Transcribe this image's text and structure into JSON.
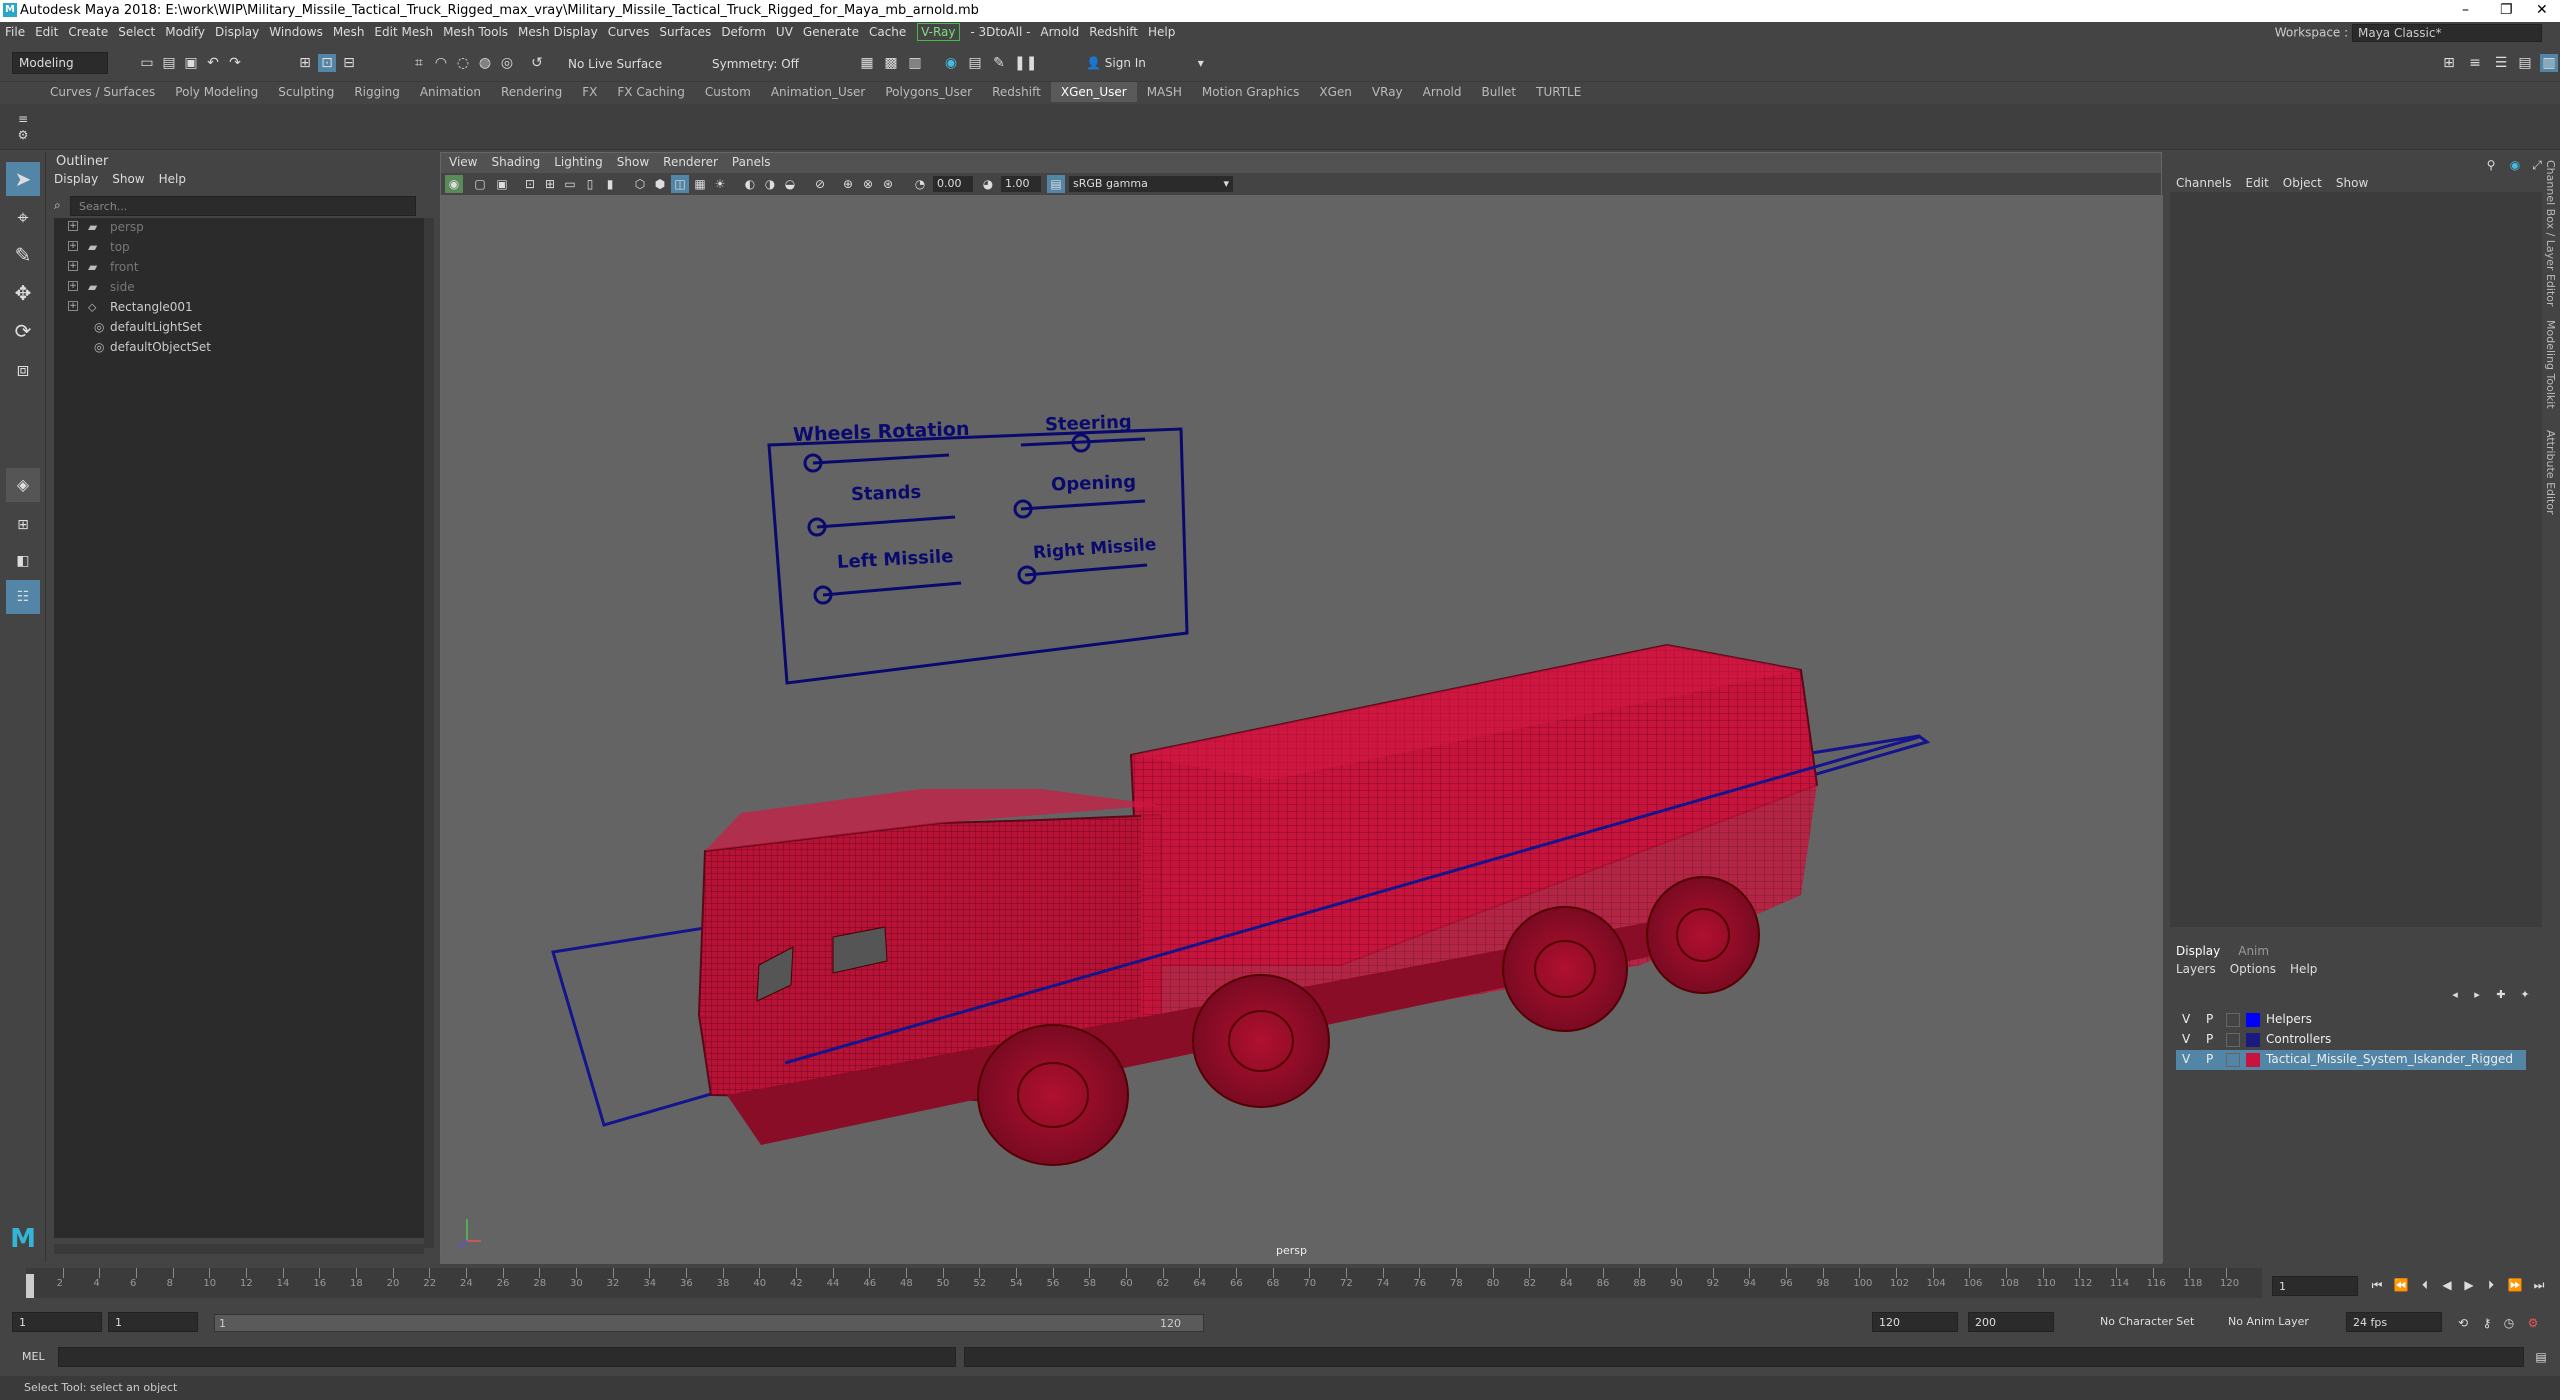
{
  "title": "Autodesk Maya 2018: E:\\work\\WIP\\Military_Missile_Tactical_Truck_Rigged_max_vray\\Military_Missile_Tactical_Truck_Rigged_for_Maya_mb_arnold.mb",
  "menus": [
    "File",
    "Edit",
    "Create",
    "Select",
    "Modify",
    "Display",
    "Windows",
    "Mesh",
    "Edit Mesh",
    "Mesh Tools",
    "Mesh Display",
    "Curves",
    "Surfaces",
    "Deform",
    "UV",
    "Generate",
    "Cache"
  ],
  "menus2": [
    "- 3DtoAll -",
    "Arnold",
    "Redshift",
    "Help"
  ],
  "vray_menu": "V-Ray",
  "workspace": {
    "label": "Workspace :",
    "value": "Maya Classic*"
  },
  "status": {
    "mode": "Modeling",
    "live_surface": "No Live Surface",
    "symmetry": "Symmetry: Off",
    "sign_in": "Sign In"
  },
  "shelf_tabs": [
    "Curves / Surfaces",
    "Poly Modeling",
    "Sculpting",
    "Rigging",
    "Animation",
    "Rendering",
    "FX",
    "FX Caching",
    "Custom",
    "Animation_User",
    "Polygons_User",
    "Redshift",
    "XGen_User",
    "MASH",
    "Motion Graphics",
    "XGen",
    "VRay",
    "Arnold",
    "Bullet",
    "TURTLE"
  ],
  "active_shelf": "XGen_User",
  "outliner": {
    "title": "Outliner",
    "menus": [
      "Display",
      "Show",
      "Help"
    ],
    "search_placeholder": "Search...",
    "items": [
      {
        "label": "persp",
        "dim": true,
        "type": "camera"
      },
      {
        "label": "top",
        "dim": true,
        "type": "camera"
      },
      {
        "label": "front",
        "dim": true,
        "type": "camera"
      },
      {
        "label": "side",
        "dim": true,
        "type": "camera"
      },
      {
        "label": "Rectangle001",
        "dim": false,
        "type": "transform"
      },
      {
        "label": "defaultLightSet",
        "dim": false,
        "type": "set"
      },
      {
        "label": "defaultObjectSet",
        "dim": false,
        "type": "set"
      }
    ]
  },
  "viewport": {
    "menus": [
      "View",
      "Shading",
      "Lighting",
      "Show",
      "Renderer",
      "Panels"
    ],
    "exposure": "0.00",
    "gamma": "1.00",
    "colorspace": "sRGB gamma",
    "camera": "persp",
    "controls": {
      "wheels": "Wheels Rotation",
      "steering": "Steering",
      "stands": "Stands",
      "opening": "Opening",
      "left_missile": "Left Missile",
      "right_missile": "Right Missile"
    }
  },
  "channelbox": {
    "menus": [
      "Channels",
      "Edit",
      "Object",
      "Show"
    ]
  },
  "layers": {
    "tabs": [
      "Display",
      "Anim"
    ],
    "menus": [
      "Layers",
      "Options",
      "Help"
    ],
    "rows": [
      {
        "v": "V",
        "p": "P",
        "name": "Helpers",
        "color": "#0000ff",
        "selected": false
      },
      {
        "v": "V",
        "p": "P",
        "name": "Controllers",
        "color": "#1a1a80",
        "selected": false
      },
      {
        "v": "V",
        "p": "P",
        "name": "Tactical_Missile_System_Iskander_Rigged",
        "color": "#c8143c",
        "selected": true
      }
    ]
  },
  "side_tabs": [
    "Channel Box / Layer Editor",
    "Modeling Toolkit",
    "Attribute Editor"
  ],
  "timeline": {
    "ticks": [
      "2",
      "4",
      "6",
      "8",
      "10",
      "12",
      "14",
      "16",
      "18",
      "20",
      "22",
      "24",
      "26",
      "28",
      "30",
      "32",
      "34",
      "36",
      "38",
      "40",
      "42",
      "44",
      "46",
      "48",
      "50",
      "52",
      "54",
      "56",
      "58",
      "60",
      "62",
      "64",
      "66",
      "68",
      "70",
      "72",
      "74",
      "76",
      "78",
      "80",
      "82",
      "84",
      "86",
      "88",
      "90",
      "92",
      "94",
      "96",
      "98",
      "100",
      "102",
      "104",
      "106",
      "108",
      "110",
      "112",
      "114",
      "116",
      "118",
      "120"
    ],
    "current_frame": "1"
  },
  "range": {
    "start": "1",
    "start2": "1",
    "range_start": "1",
    "range_end": "120",
    "end": "120",
    "end2": "200",
    "character_set": "No Character Set",
    "anim_layer": "No Anim Layer",
    "fps": "24 fps"
  },
  "cmd": {
    "label": "MEL"
  },
  "help_line": "Select Tool: select an object",
  "colors": {
    "wire": "#c8143c",
    "controller": "#0a0a6e",
    "highlight": "#5285a6"
  }
}
